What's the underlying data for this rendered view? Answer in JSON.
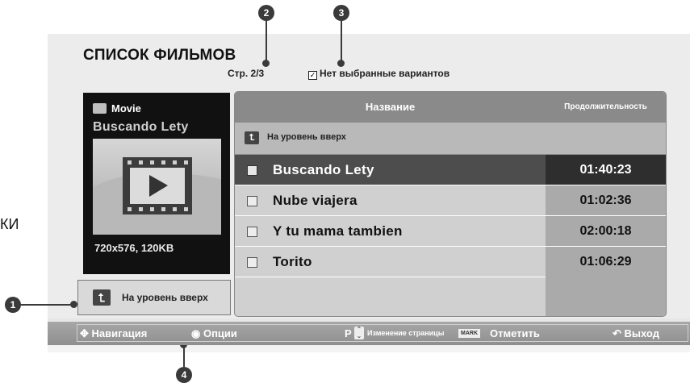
{
  "header": {
    "title": "СПИСОК ФИЛЬМОВ",
    "page_indicator": "Стр. 2/3",
    "selection_status": "Нет выбранные вариантов"
  },
  "left_edge_text": "КИ",
  "callouts": [
    "1",
    "2",
    "3",
    "4"
  ],
  "preview": {
    "type_label": "Movie",
    "title": "Buscando Lety",
    "info": "720x576, 120KB"
  },
  "up_button": {
    "label": "На уровень вверх"
  },
  "list": {
    "columns": {
      "name": "Название",
      "duration": "Продолжительность"
    },
    "up_row_label": "На уровень вверх",
    "rows": [
      {
        "name": "Buscando Lety",
        "duration": "01:40:23",
        "selected": true
      },
      {
        "name": "Nube viajera",
        "duration": "01:02:36",
        "selected": false
      },
      {
        "name": "Y tu mama tambien",
        "duration": "02:00:18",
        "selected": false
      },
      {
        "name": "Torito",
        "duration": "01:06:29",
        "selected": false
      }
    ]
  },
  "bottom_bar": {
    "navigation": "Навигация",
    "options": "Опции",
    "page_key": "P",
    "page_change": "Изменение страницы",
    "mark_key": "MARK",
    "mark": "Отметить",
    "exit": "Выход"
  },
  "colors": {
    "selected_row": "#4d4d4d",
    "header": "#8a8a8a",
    "callout": "#3a3a3a"
  }
}
